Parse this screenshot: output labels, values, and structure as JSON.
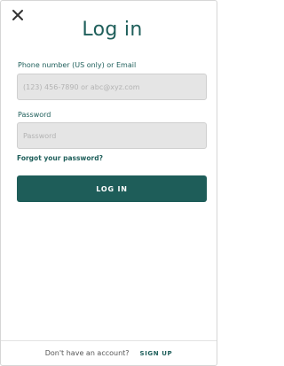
{
  "header": {
    "close_icon": "close-icon",
    "title": "Log in"
  },
  "form": {
    "phone": {
      "label": "Phone number (US only) or Email",
      "placeholder": "(123) 456-7890 or abc@xyz.com",
      "value": ""
    },
    "password": {
      "label": "Password",
      "placeholder": "Password",
      "value": ""
    },
    "forgot_link": "Forgot your password?",
    "submit_label": "LOG IN"
  },
  "footer": {
    "question": "Don't have an account?",
    "signup_label": "SIGN UP"
  },
  "colors": {
    "brand": "#1e5d59",
    "field_bg": "#e5e5e5",
    "button_text": "#ffffff"
  }
}
